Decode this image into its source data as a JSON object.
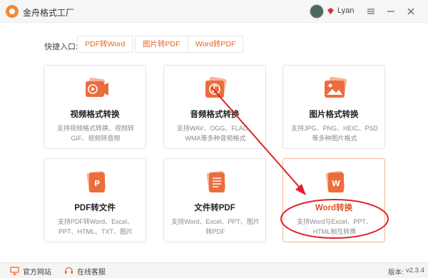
{
  "window": {
    "title": "金舟格式工厂",
    "username": "Lyan"
  },
  "quick_access": {
    "label": "快捷入口:",
    "buttons": [
      {
        "label": "PDF转Word"
      },
      {
        "label": "图片转PDF"
      },
      {
        "label": "Word转PDF"
      }
    ]
  },
  "cards": [
    {
      "title": "视频格式转换",
      "desc": "支持视频格式转换、视频转GIF、视频转音频",
      "icon": "video-icon"
    },
    {
      "title": "音频格式转换",
      "desc": "支持WAV、OGG、FLAC、WMA等多种音频格式",
      "icon": "music-icon"
    },
    {
      "title": "图片格式转换",
      "desc": "支持JPG、PNG、HEIC、PSD等多种图片格式",
      "icon": "image-icon"
    },
    {
      "title": "PDF转文件",
      "desc": "支持PDF转Word、Excel、PPT、HTML、TXT、图片",
      "icon": "pdf-icon"
    },
    {
      "title": "文件转PDF",
      "desc": "支持Word、Excel、PPT、图片转PDF",
      "icon": "document-icon"
    },
    {
      "title": "Word转换",
      "desc": "支持Word与Excel、PPT、HTML相互转换",
      "icon": "word-icon"
    }
  ],
  "footer": {
    "website": "官方网站",
    "support": "在线客服",
    "version_label": "版本:",
    "version": "v2.3.4"
  },
  "colors": {
    "accent": "#e8632b",
    "annotation_red": "#e0202a"
  }
}
